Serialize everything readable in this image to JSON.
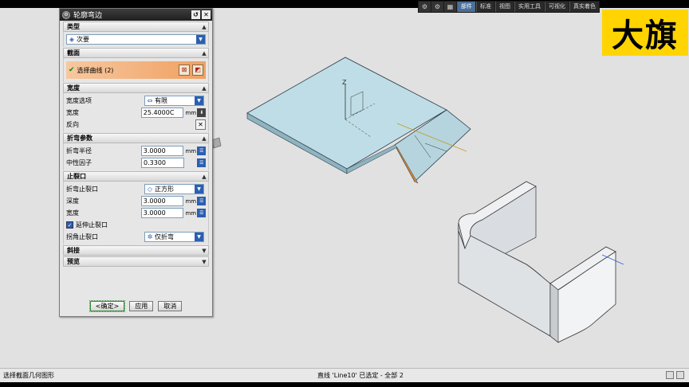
{
  "dialog": {
    "title": "轮廓弯边",
    "sections": {
      "type": {
        "label": "类型",
        "value": "次要"
      },
      "section": {
        "label": "截面",
        "select_curve": "选择曲线 (2)"
      },
      "width": {
        "label": "宽度",
        "option_label": "宽度选项",
        "option_value": "有限",
        "width_label": "宽度",
        "width_value": "25.4000C",
        "unit": "mm",
        "reverse_label": "反向"
      },
      "bend": {
        "label": "折弯参数",
        "radius_label": "折弯半径",
        "radius_value": "3.0000",
        "neutral_label": "中性因子",
        "neutral_value": "0.3300",
        "unit": "mm"
      },
      "relief": {
        "label": "止裂口",
        "bend_relief_label": "折弯止裂口",
        "bend_relief_value": "正方形",
        "depth_label": "深度",
        "depth_value": "3.0000",
        "width_label": "宽度",
        "width_value": "3.0000",
        "unit": "mm",
        "extend_label": "延伸止裂口",
        "corner_label": "拐角止裂口",
        "corner_value": "仅折弯"
      },
      "miter": {
        "label": "斜接"
      },
      "preview": {
        "label": "预览"
      }
    },
    "buttons": {
      "ok": "<确定>",
      "apply": "应用",
      "cancel": "取消"
    }
  },
  "toolbar": {
    "tabs": [
      "部件",
      "标准",
      "视图",
      "实用工具",
      "可视化",
      "真实着色"
    ]
  },
  "logo_text": "大旗",
  "axis": {
    "z_label": "Z"
  },
  "status": {
    "left": "选择截面几何图形",
    "center": "直线 'Line10' 已选定 - 全部 2"
  }
}
